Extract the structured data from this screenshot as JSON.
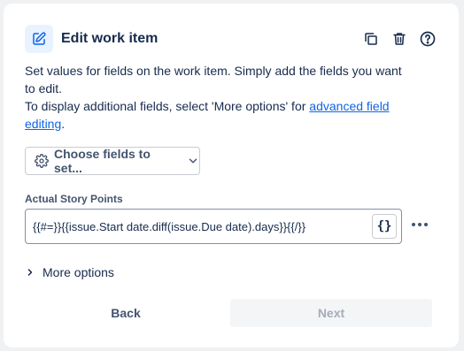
{
  "header": {
    "title": "Edit work item",
    "icon": "edit-pencil-icon",
    "actions": [
      "duplicate-icon",
      "delete-icon",
      "help-icon"
    ]
  },
  "description": {
    "line1": "Set values for fields on the work item. Simply add the fields you want to edit.",
    "line2_prefix": "To display additional fields, select 'More options' for ",
    "link_text": "advanced field editing",
    "line2_suffix": "."
  },
  "choose_fields": {
    "label": "Choose fields to set...",
    "icon": "gear-icon"
  },
  "field": {
    "label": "Actual Story Points",
    "value": "{{#=}}{{issue.Start date.diff(issue.Due date).days}}{{/}}",
    "smart_value_button": "{}"
  },
  "more_options": {
    "label": "More options"
  },
  "footer": {
    "back_label": "Back",
    "next_label": "Next"
  },
  "colors": {
    "accent": "#0c66e4",
    "icon_bg": "#e9f2ff",
    "text": "#172b4d",
    "disabled": "#a5adba"
  }
}
